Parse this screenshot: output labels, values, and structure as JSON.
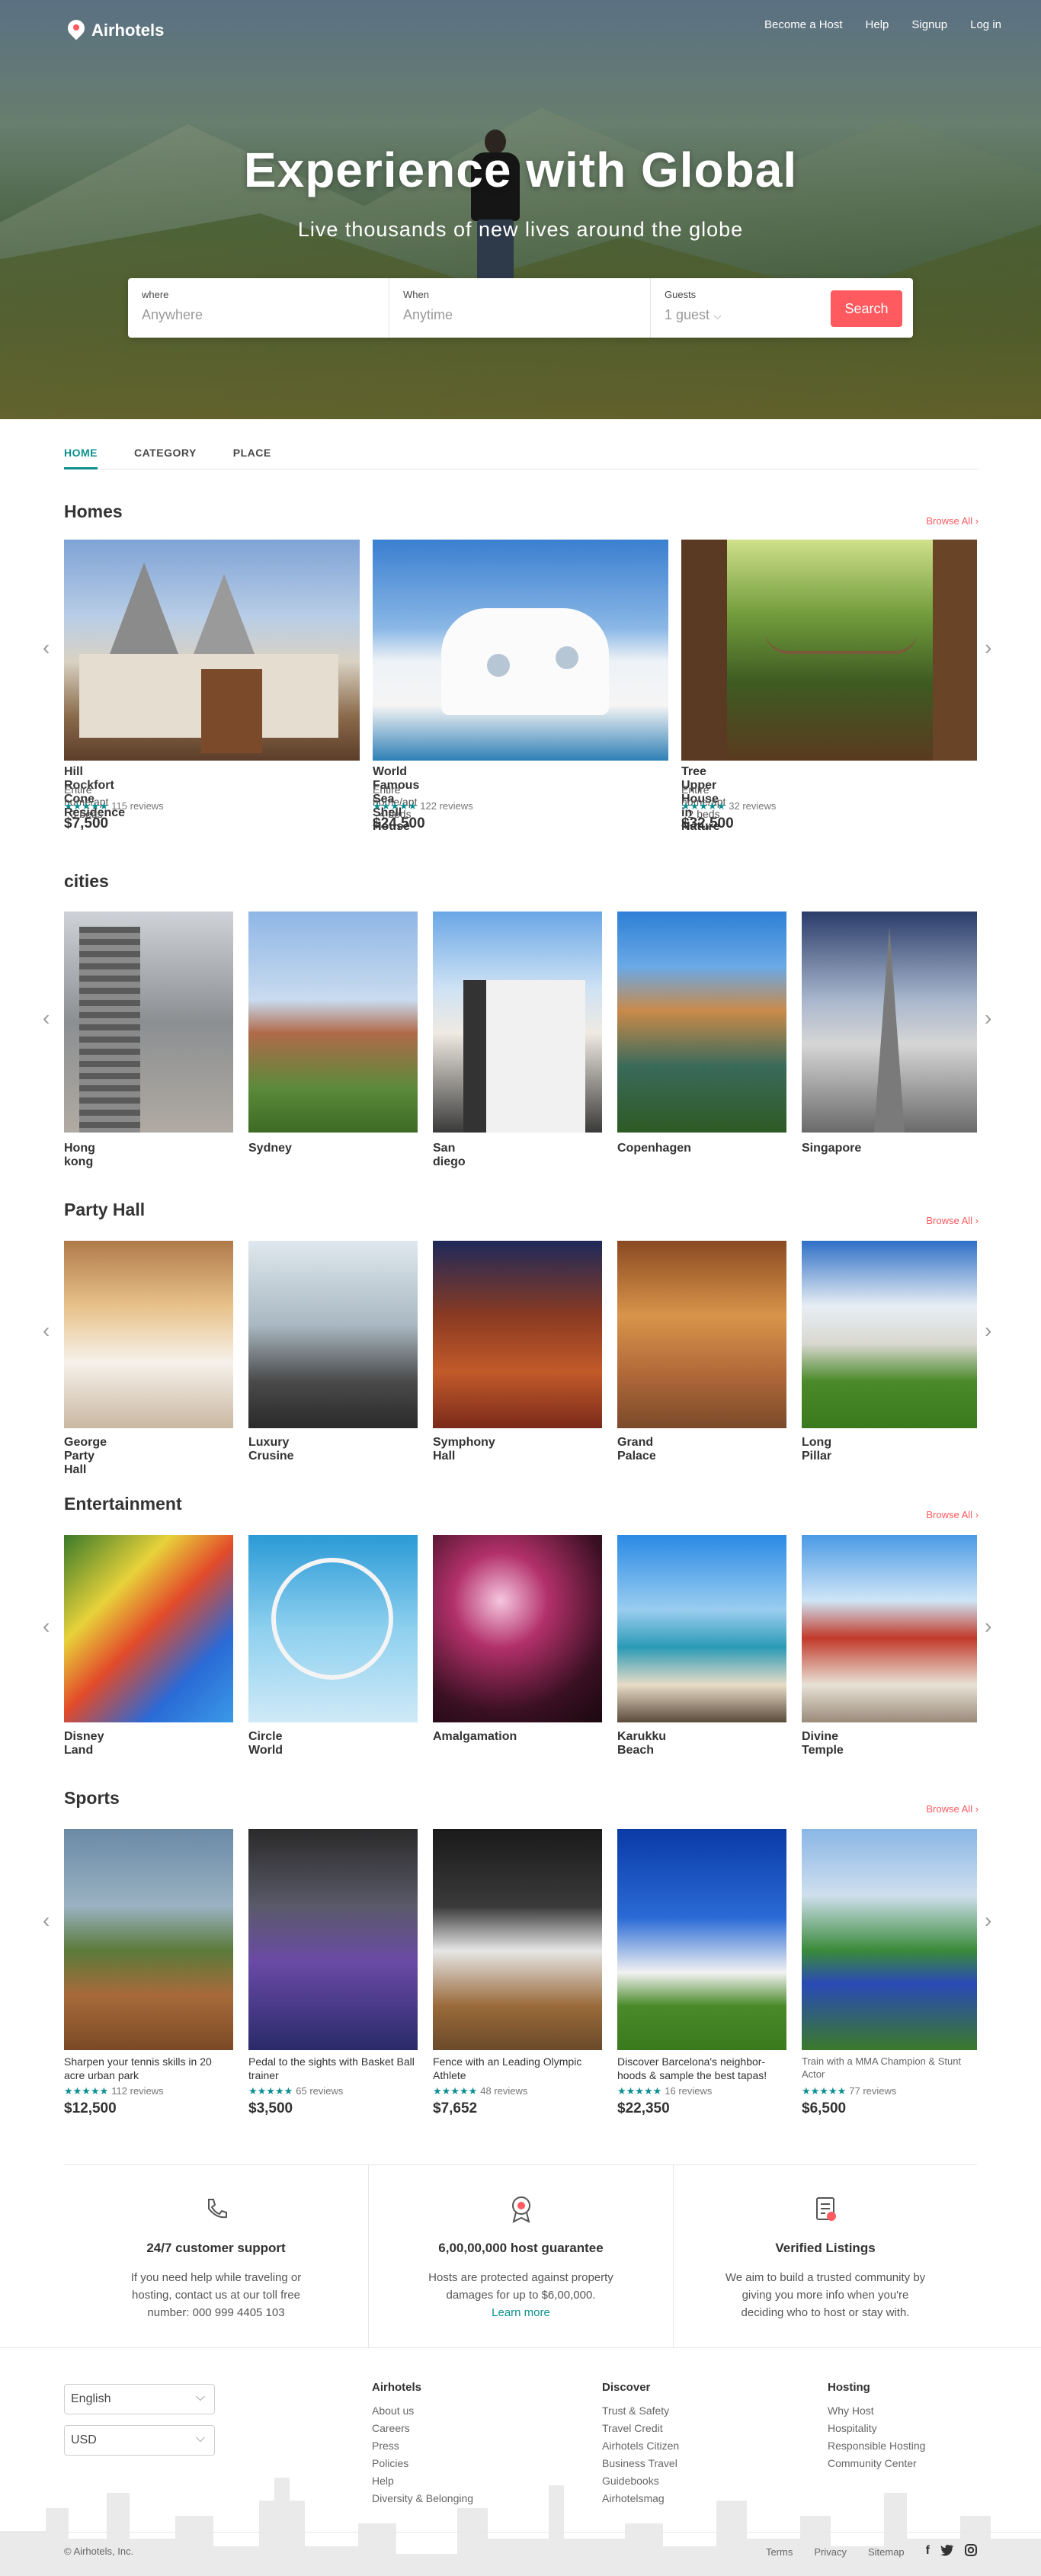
{
  "header": {
    "brand": "Airhotels",
    "nav": [
      "Become a Host",
      "Help",
      "Signup",
      "Log in"
    ]
  },
  "hero": {
    "title": "Experience with Global",
    "subtitle": "Live thousands of new lives around the globe"
  },
  "search": {
    "where_label": "where",
    "where_placeholder": "Anywhere",
    "when_label": "When",
    "when_placeholder": "Anytime",
    "guests_label": "Guests",
    "guests_value": "1 guest",
    "button": "Search"
  },
  "tabs": [
    "HOME",
    "CATEGORY",
    "PLACE"
  ],
  "browse_all": "Browse All",
  "homes": {
    "title": "Homes",
    "items": [
      {
        "name": "Hill Rockfort Cone Residence",
        "meta": "Entire home/apt · 3 beds",
        "stars": "★★★★★",
        "reviews": "115 reviews",
        "price": "$7,500"
      },
      {
        "name": "World Famous Sea Shell  House",
        "meta": "Entire home/apt · 4 beds",
        "stars": "★★★★★",
        "reviews": "122 reviews",
        "price": "$24,500"
      },
      {
        "name": "Tree Upper House in Nature",
        "meta": "Entire home/apt · 2 beds",
        "stars": "★★★★★",
        "reviews": "32 reviews",
        "price": "$32,500"
      }
    ]
  },
  "cities": {
    "title": "cities",
    "items": [
      "Hong kong",
      "Sydney",
      "San diego",
      "Copenhagen",
      "Singapore"
    ]
  },
  "party": {
    "title": "Party Hall",
    "items": [
      "George Party Hall",
      "Luxury Crusine",
      "Symphony Hall",
      "Grand Palace",
      "Long Pillar"
    ]
  },
  "entertainment": {
    "title": "Entertainment",
    "items": [
      "Disney Land",
      "Circle World",
      "Amalgamation",
      "Karukku Beach",
      "Divine Temple"
    ]
  },
  "sports": {
    "title": "Sports",
    "items": [
      {
        "name": "Sharpen your tennis skills in 20 acre urban park",
        "stars": "★★★★★",
        "reviews": "112 reviews",
        "price": "$12,500"
      },
      {
        "name": "Pedal to the sights with Basket Ball trainer",
        "stars": "★★★★★",
        "reviews": "65 reviews",
        "price": "$3,500"
      },
      {
        "name": "Fence with an Leading Olympic Athlete",
        "stars": "★★★★★",
        "reviews": "48 reviews",
        "price": "$7,652"
      },
      {
        "name": "Discover Barcelona's neighbor-hoods & sample the best tapas!",
        "stars": "★★★★★",
        "reviews": "16 reviews",
        "price": "$22,350"
      },
      {
        "name": "Train with a MMA Champion & Stunt Actor",
        "stars": "★★★★★",
        "reviews": "77 reviews",
        "price": "$6,500"
      }
    ]
  },
  "features": [
    {
      "title": "24/7 customer support",
      "text": "If you need help while traveling or hosting, contact us at our toll free number: 000 999 4405 103",
      "icon": "phone-icon"
    },
    {
      "title": "6,00,00,000 host guarantee",
      "text": "Hosts are protected against property damages for up to $6,00,000.",
      "link": "Learn more",
      "icon": "award-icon"
    },
    {
      "title": "Verified Listings",
      "text": "We aim to build a trusted community by giving you more info when you're deciding who to host or stay with.",
      "icon": "verified-icon"
    }
  ],
  "footer": {
    "language": "English",
    "currency": "USD",
    "cols": [
      {
        "title": "Airhotels",
        "items": [
          "About us",
          "Careers",
          "Press",
          "Policies",
          "Help",
          "Diversity & Belonging"
        ]
      },
      {
        "title": "Discover",
        "items": [
          "Trust & Safety",
          "Travel Credit",
          "Airhotels Citizen",
          "Business Travel",
          "Guidebooks",
          "Airhotelsmag"
        ]
      },
      {
        "title": "Hosting",
        "items": [
          "Why Host",
          "Hospitality",
          "Responsible Hosting",
          "Community Center"
        ]
      }
    ],
    "copyright": "© Airhotels, Inc.",
    "links": [
      "Terms",
      "Privacy",
      "Sitemap"
    ],
    "social": [
      "f",
      "t",
      "ig"
    ]
  },
  "colors": {
    "accent": "#ff5a5f",
    "teal": "#0d8f8f"
  }
}
